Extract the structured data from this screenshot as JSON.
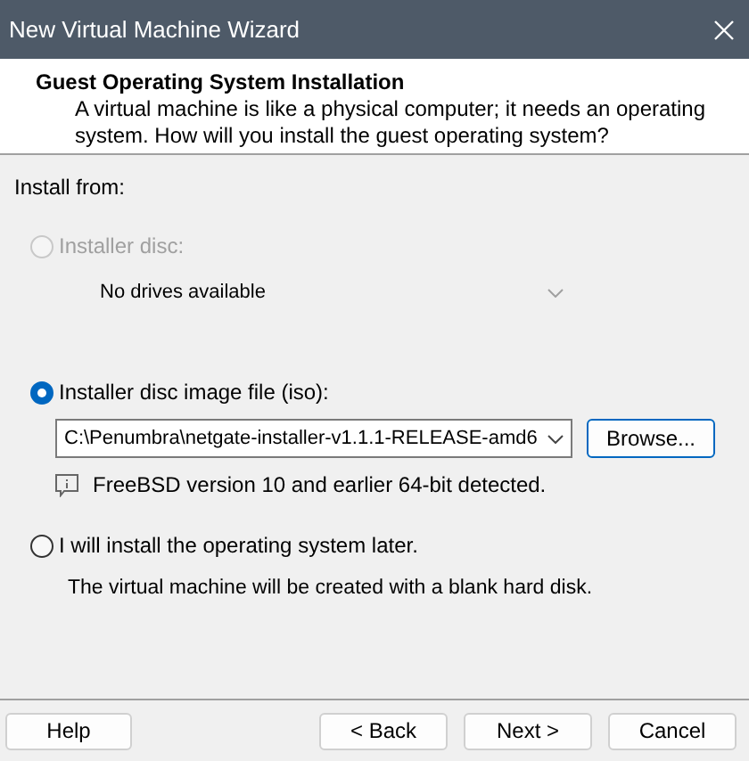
{
  "window": {
    "title": "New Virtual Machine Wizard"
  },
  "header": {
    "title": "Guest Operating System Installation",
    "description": "A virtual machine is like a physical computer; it needs an operating system. How will you install the guest operating system?"
  },
  "group_label": "Install from:",
  "options": [
    {
      "label": "Installer disc:",
      "selected": false,
      "disabled": true,
      "dropdown": {
        "value": "No drives available",
        "disabled": true
      }
    },
    {
      "label": "Installer disc image file (iso):",
      "selected": true,
      "disabled": false,
      "dropdown": {
        "value": "C:\\Penumbra\\netgate-installer-v1.1.1-RELEASE-amd6",
        "disabled": false
      },
      "browse_button": "Browse...",
      "info": "FreeBSD version 10 and earlier 64-bit detected."
    },
    {
      "label": "I will install the operating system later.",
      "selected": false,
      "disabled": false,
      "note": "The virtual machine will be created with a blank hard disk."
    }
  ],
  "buttons": {
    "help": "Help",
    "back": "< Back",
    "next": "Next >",
    "cancel": "Cancel"
  }
}
